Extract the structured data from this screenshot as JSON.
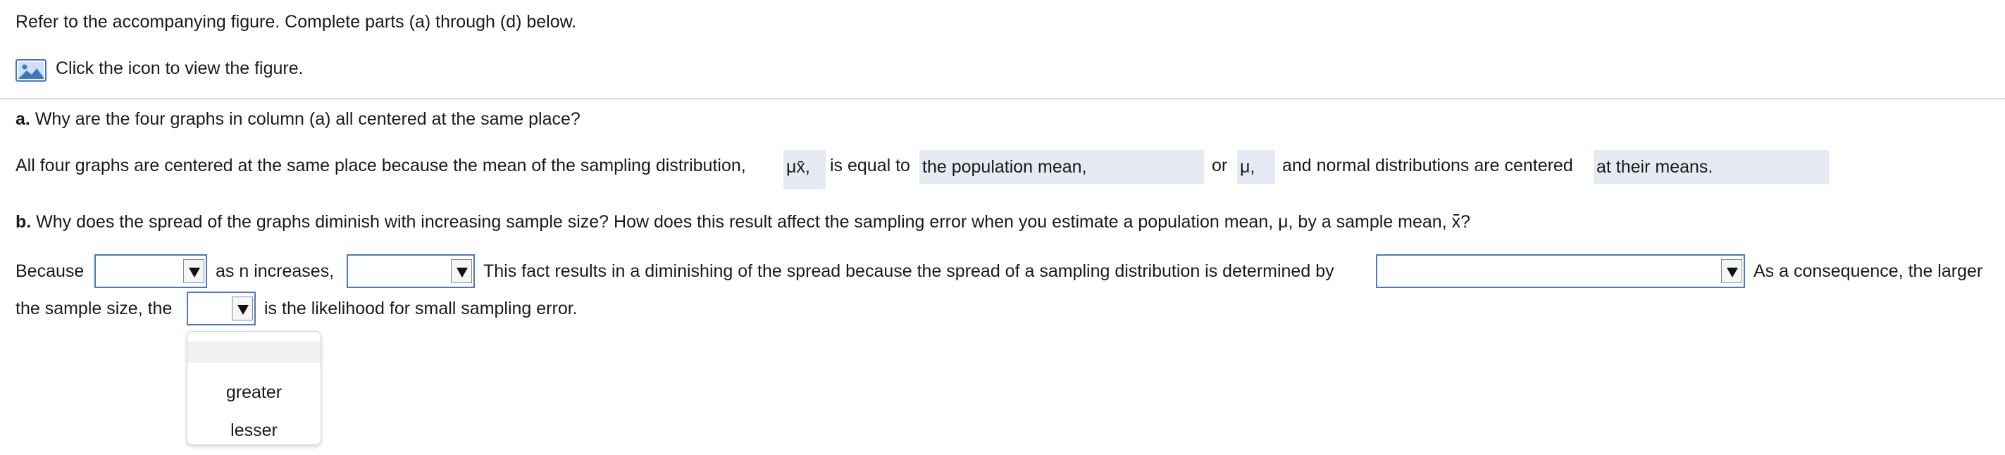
{
  "instructions": "Refer to the accompanying figure. Complete parts (a) through (d) below.",
  "figure_link": "Click the icon to view the figure.",
  "part_a": {
    "label": "a.",
    "question": "Why are the four graphs in column (a) all centered at the same place?",
    "answer_prefix": "All four graphs are centered at the same place because the mean of the sampling distribution,",
    "mu_xbar": "μx̄,",
    "is_equal_to": "is equal to",
    "blank1_value": "the population mean,",
    "or_text": "or",
    "mu": "μ,",
    "and_text": "and normal distributions are centered",
    "blank2_value": "at their means."
  },
  "part_b": {
    "label": "b.",
    "question": "Why does the spread of the graphs diminish with increasing sample size? How does this result affect the sampling error when you estimate a population mean, μ, by a sample mean, ",
    "xbar": "x",
    "question_end": "?",
    "because": "Because",
    "as_n_increases": "as n increases,",
    "fact_text": "This fact results in a diminishing of the spread because the spread of a sampling distribution is determined by",
    "consequence": "As a consequence, the larger",
    "sample_size_the": "the sample size, the",
    "likelihood": "is the likelihood for small sampling error.",
    "dropdown_options": [
      "greater",
      "lesser"
    ]
  }
}
